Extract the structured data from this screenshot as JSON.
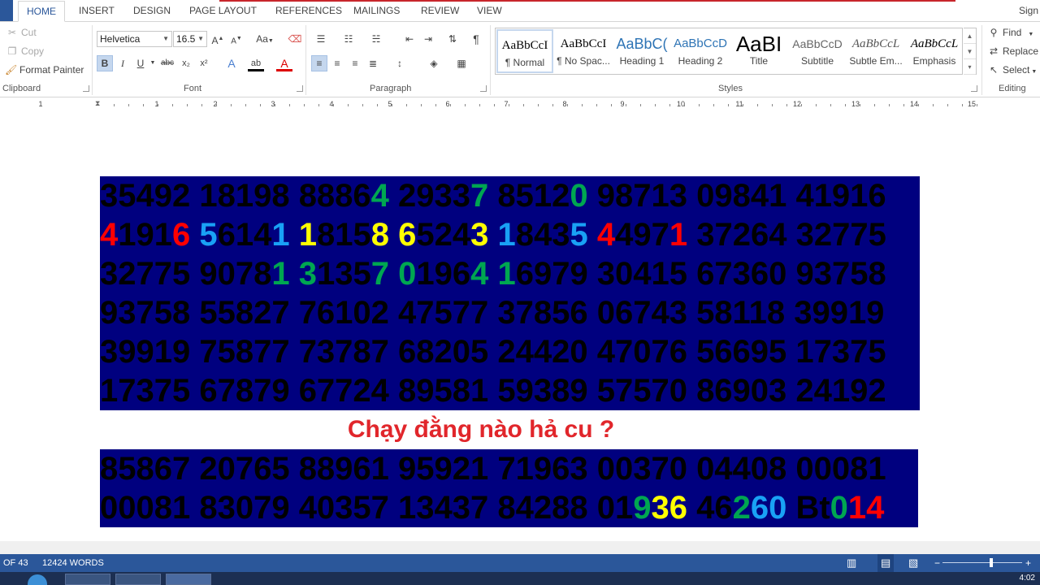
{
  "tabs": [
    "HOME",
    "INSERT",
    "DESIGN",
    "PAGE LAYOUT",
    "REFERENCES",
    "MAILINGS",
    "REVIEW",
    "VIEW"
  ],
  "account": "Sign",
  "clipboard": {
    "cut": "Cut",
    "copy": "Copy",
    "format_painter": "Format Painter",
    "label": "Clipboard"
  },
  "font": {
    "name": "Helvetica",
    "size": "16.5",
    "label": "Font",
    "case_label": "Aa"
  },
  "paragraph": {
    "label": "Paragraph"
  },
  "styles": {
    "label": "Styles",
    "items": [
      {
        "preview": "AaBbCcI",
        "name": "¶ Normal"
      },
      {
        "preview": "AaBbCcI",
        "name": "¶ No Spac..."
      },
      {
        "preview": "AaBbC(",
        "name": "Heading 1"
      },
      {
        "preview": "AaBbCcD",
        "name": "Heading 2"
      },
      {
        "preview": "AaBI",
        "name": "Title"
      },
      {
        "preview": "AaBbCcD",
        "name": "Subtitle"
      },
      {
        "preview": "AaBbCcL",
        "name": "Subtle Em..."
      },
      {
        "preview": "AaBbCcL",
        "name": "Emphasis"
      }
    ]
  },
  "editing": {
    "find": "Find",
    "replace": "Replace",
    "select": "Select",
    "label": "Editing"
  },
  "ruler": [
    "1",
    "1",
    "2",
    "3",
    "4",
    "5",
    "6",
    "7",
    "8",
    "9",
    "10",
    "11",
    "12",
    "13",
    "14",
    "15"
  ],
  "colors": {
    "ribbon_accent": "#2b579a",
    "block_bg": "#00007f",
    "red": "#ff0000",
    "blue": "#19a1f5",
    "yellow": "#ffff00",
    "green": "#00a651",
    "caption": "#e1262b"
  },
  "block1": [
    [
      [
        "35492 18198 8886",
        "k"
      ],
      [
        "4",
        "g"
      ],
      [
        " 2933",
        "k"
      ],
      [
        "7",
        "g"
      ],
      [
        " 8512",
        "k"
      ],
      [
        "0",
        "g"
      ],
      [
        " 98713 09841 41916",
        "k"
      ]
    ],
    [
      [
        "4",
        "r"
      ],
      [
        "191",
        "k"
      ],
      [
        "6",
        "r"
      ],
      [
        " ",
        "k"
      ],
      [
        "5",
        "b"
      ],
      [
        "614",
        "k"
      ],
      [
        "1",
        "b"
      ],
      [
        " ",
        "k"
      ],
      [
        "1",
        "y"
      ],
      [
        "815",
        "k"
      ],
      [
        "8",
        "y"
      ],
      [
        " ",
        "k"
      ],
      [
        "6",
        "y"
      ],
      [
        "524",
        "k"
      ],
      [
        "3",
        "y"
      ],
      [
        " ",
        "k"
      ],
      [
        "1",
        "b"
      ],
      [
        "843",
        "k"
      ],
      [
        "5",
        "b"
      ],
      [
        " ",
        "k"
      ],
      [
        "4",
        "r"
      ],
      [
        "497",
        "k"
      ],
      [
        "1",
        "r"
      ],
      [
        " 37264 32775",
        "k"
      ]
    ],
    [
      [
        "32775 9078",
        "k"
      ],
      [
        "1",
        "g"
      ],
      [
        " ",
        "k"
      ],
      [
        "3",
        "g"
      ],
      [
        "135",
        "k"
      ],
      [
        "7",
        "g"
      ],
      [
        " ",
        "k"
      ],
      [
        "0",
        "g"
      ],
      [
        "196",
        "k"
      ],
      [
        "4",
        "g"
      ],
      [
        " ",
        "k"
      ],
      [
        "1",
        "g"
      ],
      [
        "6979 30415 67360 93758",
        "k"
      ]
    ],
    [
      [
        "93758 55827 76102 47577 37856 06743 58118 39919",
        "k"
      ]
    ],
    [
      [
        "39919 75877 73787 68205 24420 47076 56695 17375",
        "k"
      ]
    ],
    [
      [
        "17375 67879 67724 89581 59389 57570 86903 24192",
        "k"
      ]
    ]
  ],
  "caption": "Chạy đằng nào hả cu ?",
  "block2": [
    [
      [
        "85867 20765 88961 95921 71963 00370 04408 00081",
        "k"
      ]
    ],
    [
      [
        "00081 83079 40357 13437 84288 01",
        "k"
      ],
      [
        "9",
        "g"
      ],
      [
        "36",
        "y"
      ],
      [
        " 46",
        "k"
      ],
      [
        "2",
        "g"
      ],
      [
        "60",
        "b"
      ],
      [
        " Bt",
        "k"
      ],
      [
        "0",
        "g"
      ],
      [
        "14",
        "r"
      ]
    ]
  ],
  "status": {
    "page": "OF 43",
    "words": "12424 WORDS"
  },
  "clock": "4:02"
}
